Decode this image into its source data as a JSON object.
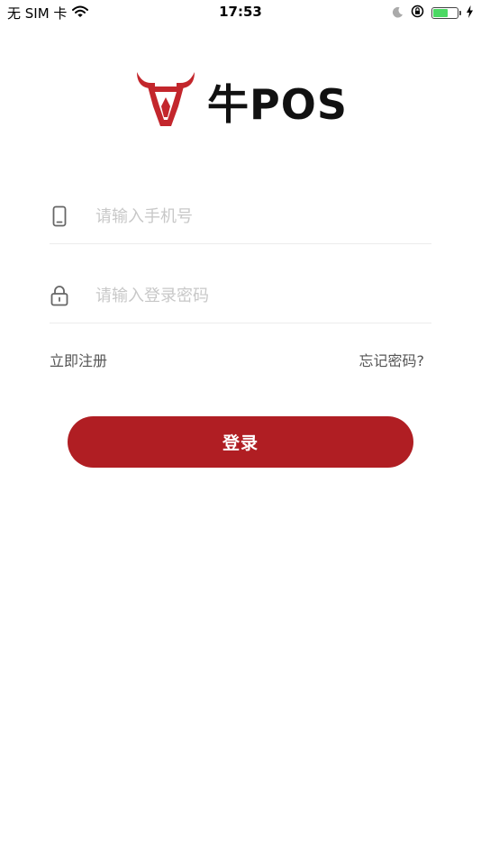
{
  "status_bar": {
    "carrier": "无 SIM 卡",
    "time": "17:53",
    "battery_level": 0.62,
    "icons": [
      "wifi-icon",
      "moon-icon",
      "rotation-lock-icon",
      "battery-icon",
      "charging-bolt-icon"
    ]
  },
  "logo": {
    "brand_text": "牛POS",
    "icon": "bull-head-icon",
    "brand_color": "#c3262c"
  },
  "form": {
    "phone": {
      "placeholder": "请输入手机号",
      "value": "",
      "icon": "phone-icon"
    },
    "password": {
      "placeholder": "请输入登录密码",
      "value": "",
      "icon": "lock-icon"
    }
  },
  "links": {
    "register": "立即注册",
    "forgot_password": "忘记密码?"
  },
  "login_button": {
    "label": "登录",
    "color": "#b01e23"
  }
}
